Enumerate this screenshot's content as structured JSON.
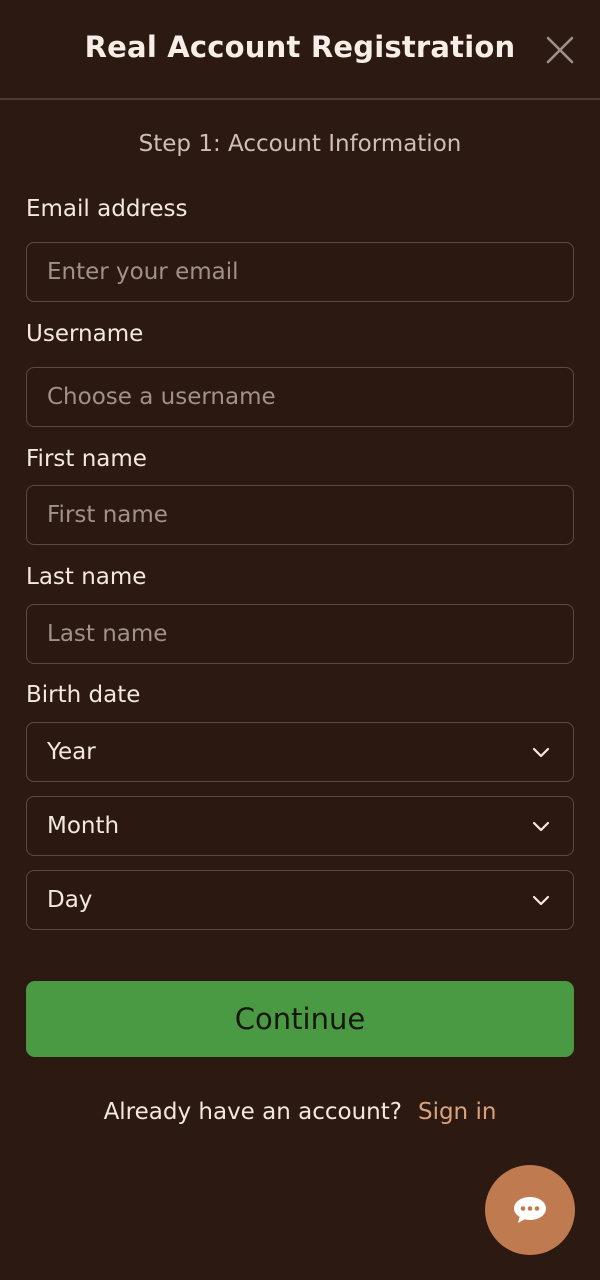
{
  "header": {
    "title": "Real Account Registration"
  },
  "form": {
    "step": "Step 1: Account Information",
    "email": {
      "label": "Email address",
      "placeholder": "Enter your email",
      "value": ""
    },
    "username": {
      "label": "Username",
      "placeholder": "Choose a username",
      "value": ""
    },
    "first_name": {
      "label": "First name",
      "placeholder": "First name",
      "value": ""
    },
    "last_name": {
      "label": "Last name",
      "placeholder": "Last name",
      "value": ""
    },
    "birth_date": {
      "label": "Birth date",
      "year": "Year",
      "month": "Month",
      "day": "Day"
    },
    "continue_label": "Continue"
  },
  "footer": {
    "prompt": "Already have an account?",
    "signin_label": "Sign in"
  },
  "icons": {
    "close": "close-icon",
    "chevron": "chevron-down-icon",
    "chat": "chat-bubble-icon"
  },
  "colors": {
    "background": "#2c1911",
    "primary_button": "#4a9a44",
    "link": "#d9a17c",
    "chat_button": "#c07a4f"
  }
}
